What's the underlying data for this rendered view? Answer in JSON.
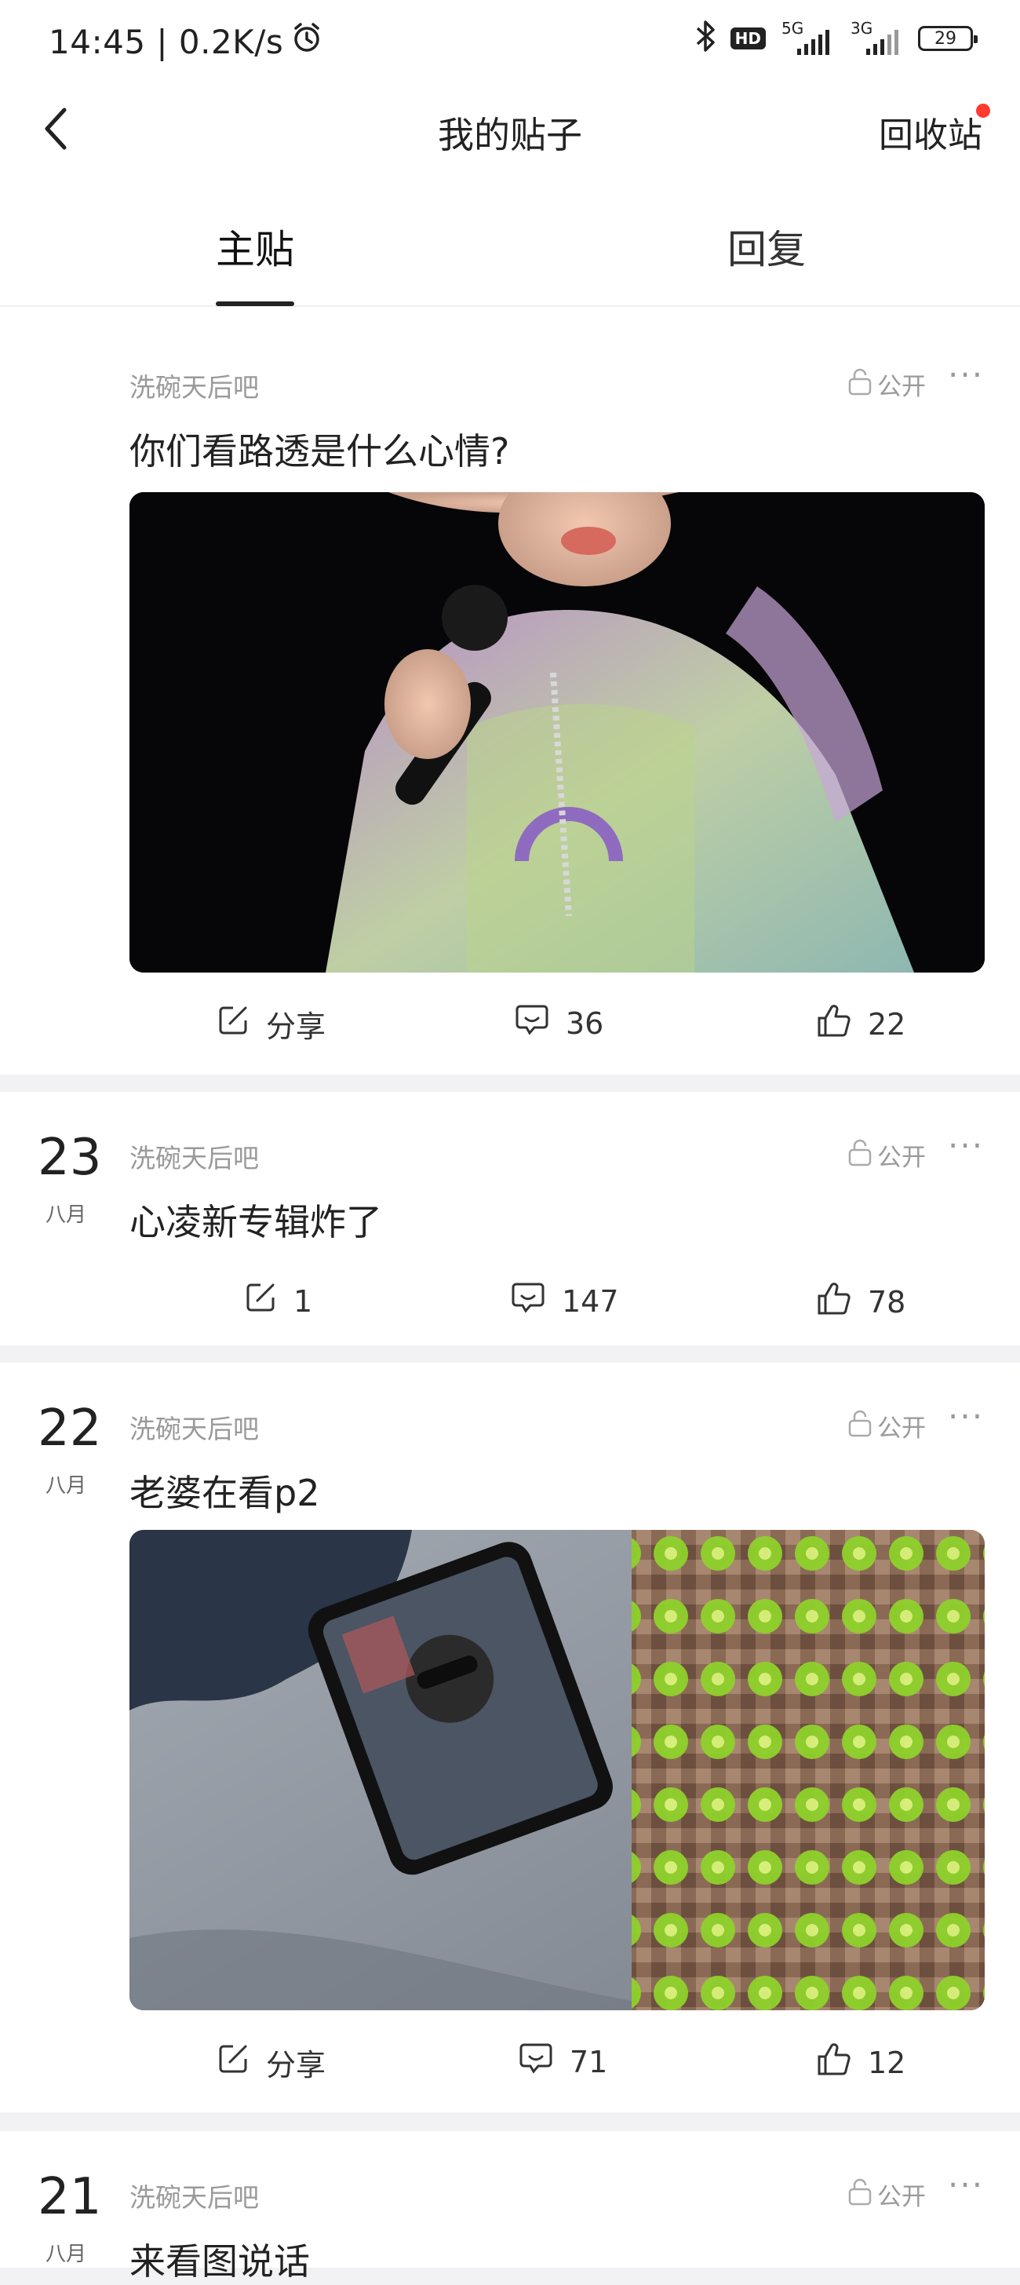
{
  "status": {
    "time_speed": "14:45 | 0.2K/s",
    "hd": "HD",
    "net1": "5G",
    "net2": "3G",
    "battery": "29"
  },
  "nav": {
    "title": "我的贴子",
    "recycle": "回收站"
  },
  "tabs": {
    "main": "主贴",
    "reply": "回复"
  },
  "posts": [
    {
      "day": "",
      "month": "",
      "forum": "洗碗天后吧",
      "visibility": "公开",
      "title": "你们看路透是什么心情?",
      "share": "分享",
      "comments": "36",
      "likes": "22"
    },
    {
      "day": "23",
      "month": "八月",
      "forum": "洗碗天后吧",
      "visibility": "公开",
      "title": "心凌新专辑炸了",
      "share": "1",
      "comments": "147",
      "likes": "78"
    },
    {
      "day": "22",
      "month": "八月",
      "forum": "洗碗天后吧",
      "visibility": "公开",
      "title": "老婆在看p2",
      "share": "分享",
      "comments": "71",
      "likes": "12"
    },
    {
      "day": "21",
      "month": "八月",
      "forum": "洗碗天后吧",
      "visibility": "公开",
      "title": "来看图说话"
    }
  ],
  "icons": {
    "back": "chevron-left-icon",
    "alarm": "alarm-clock-icon",
    "bluetooth": "bluetooth-icon",
    "lock": "lock-open-icon",
    "more": "more-dots-icon",
    "share": "share-edit-icon",
    "comment": "comment-bubble-icon",
    "like": "thumb-up-icon"
  },
  "colors": {
    "accent_red": "#ff3b30",
    "meta_gray": "#9a9a9a",
    "page_bg": "#f2f2f5"
  }
}
